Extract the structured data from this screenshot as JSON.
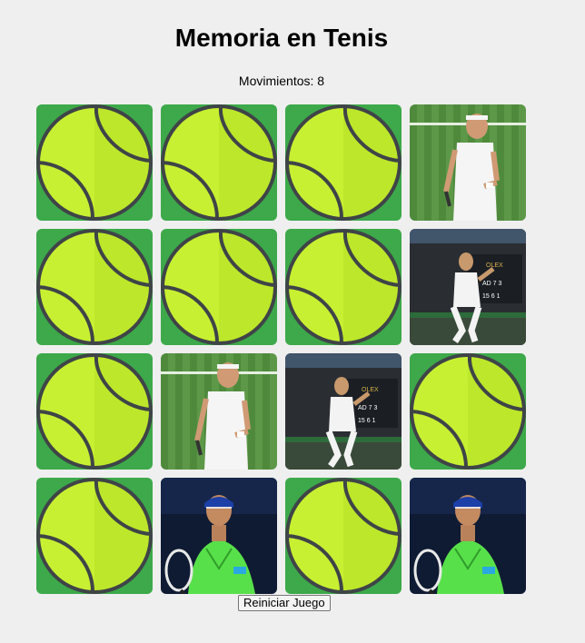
{
  "game": {
    "title": "Memoria en Tenis",
    "moves_label": "Movimientos: 8",
    "reset_label": "Reiniciar Juego"
  },
  "board": {
    "rows": 4,
    "cols": 4,
    "cards": [
      {
        "state": "hidden"
      },
      {
        "state": "hidden"
      },
      {
        "state": "hidden"
      },
      {
        "state": "revealed",
        "player": "federer"
      },
      {
        "state": "hidden"
      },
      {
        "state": "hidden"
      },
      {
        "state": "hidden"
      },
      {
        "state": "revealed",
        "player": "alcaraz"
      },
      {
        "state": "hidden"
      },
      {
        "state": "revealed",
        "player": "federer"
      },
      {
        "state": "revealed",
        "player": "alcaraz"
      },
      {
        "state": "hidden"
      },
      {
        "state": "hidden"
      },
      {
        "state": "revealed",
        "player": "nadal"
      },
      {
        "state": "hidden"
      },
      {
        "state": "revealed",
        "player": "nadal"
      }
    ]
  },
  "colors": {
    "card_back": "#3da94a",
    "ball": "#c8f032",
    "ball_shade": "#a8d81e",
    "seam": "#3f4447"
  }
}
